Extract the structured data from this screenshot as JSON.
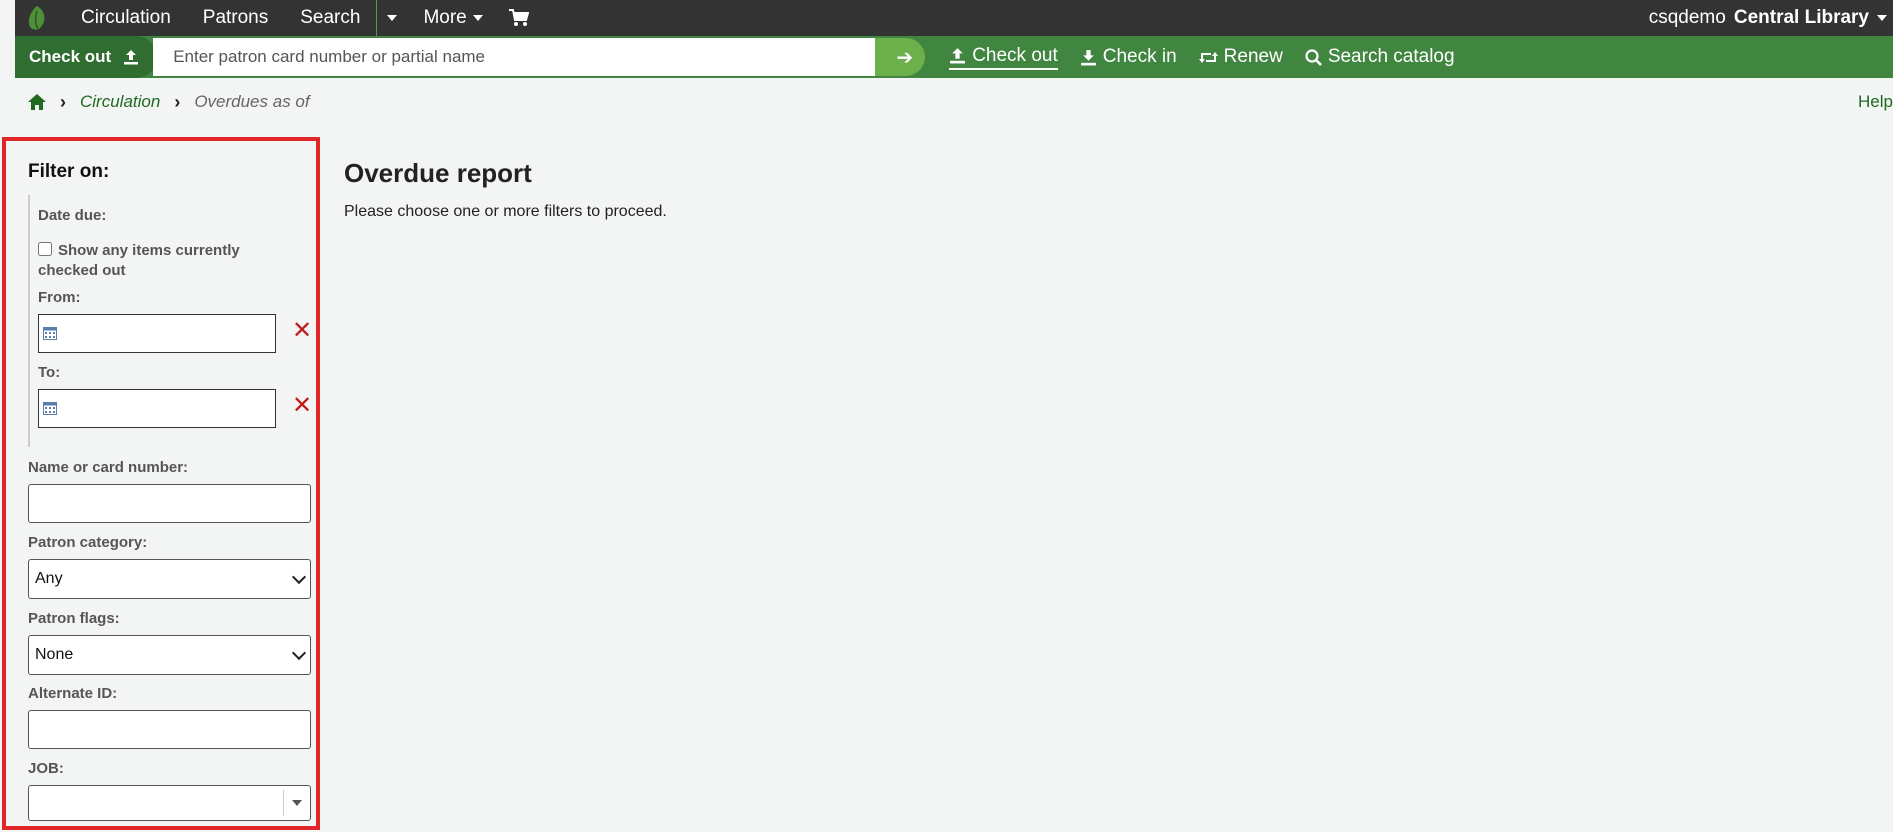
{
  "topnav": {
    "items": [
      "Circulation",
      "Patrons",
      "Search",
      "More"
    ],
    "library_user": "csqdemo",
    "library_name": "Central Library"
  },
  "checkout_bar": {
    "label": "Check out",
    "placeholder": "Enter patron card number or partial name",
    "links": [
      "Check out",
      "Check in",
      "Renew",
      "Search catalog"
    ]
  },
  "breadcrumb": {
    "items": [
      "Circulation",
      "Overdues as of"
    ],
    "help": "Help"
  },
  "filter": {
    "heading": "Filter on:",
    "date_due_label": "Date due:",
    "show_checked_out_label": "Show any items currently checked out",
    "from_label": "From:",
    "to_label": "To:",
    "name_label": "Name or card number:",
    "category_label": "Patron category:",
    "category_value": "Any",
    "flags_label": "Patron flags:",
    "flags_value": "None",
    "altid_label": "Alternate ID:",
    "job_label": "JOB:",
    "clear_symbol": "✕"
  },
  "main": {
    "title": "Overdue report",
    "message": "Please choose one or more filters to proceed."
  },
  "colors": {
    "topbar": "#343333",
    "greenbar": "#408540",
    "accent_link": "#206a20",
    "highlight_border": "#e1262a"
  }
}
